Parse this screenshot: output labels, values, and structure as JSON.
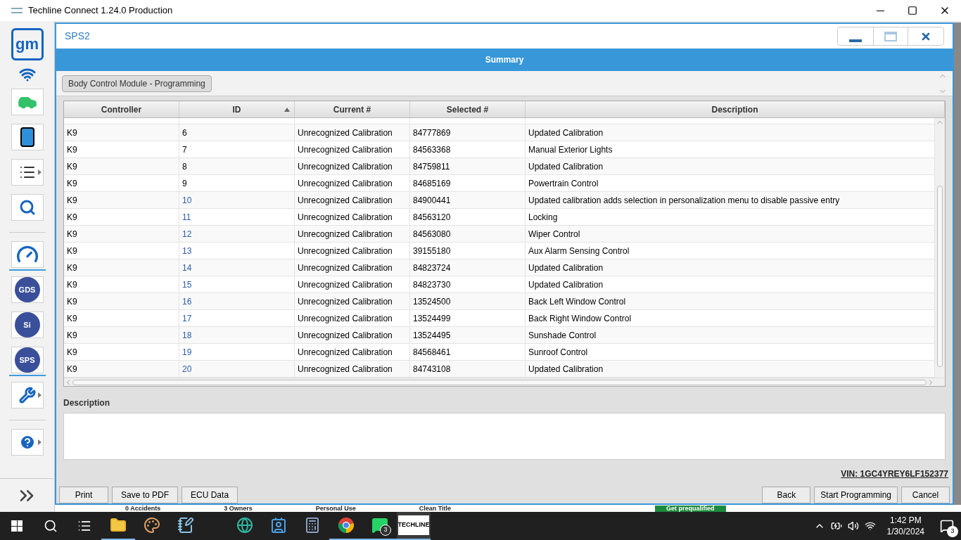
{
  "window": {
    "title": "Techline Connect 1.24.0 Production"
  },
  "sidebar": {
    "logo": "gm",
    "items": [
      {
        "kind": "car",
        "selected": false,
        "menu": false
      },
      {
        "kind": "tablet",
        "selected": false,
        "menu": false
      },
      {
        "kind": "list",
        "selected": false,
        "menu": true
      },
      {
        "kind": "search",
        "selected": false,
        "menu": false
      },
      {
        "kind": "divider"
      },
      {
        "kind": "gauge",
        "selected": true,
        "menu": false
      },
      {
        "kind": "badge",
        "label": "GDS",
        "selected": false,
        "menu": false
      },
      {
        "kind": "badge",
        "label": "Si",
        "selected": false,
        "menu": false
      },
      {
        "kind": "badge",
        "label": "SPS",
        "selected": true,
        "menu": false
      },
      {
        "kind": "wrench",
        "selected": false,
        "menu": true
      },
      {
        "kind": "divider"
      },
      {
        "kind": "help",
        "selected": false,
        "menu": true
      }
    ]
  },
  "dialog": {
    "title": "SPS2",
    "banner": "Summary",
    "module_tab": "Body Control Module - Programming",
    "table": {
      "columns": [
        {
          "label": "Controller",
          "sorted": false
        },
        {
          "label": "ID",
          "sorted": true
        },
        {
          "label": "Current #",
          "sorted": false
        },
        {
          "label": "Selected #",
          "sorted": false
        },
        {
          "label": "Description",
          "sorted": false
        }
      ],
      "rows": [
        {
          "controller": "K9",
          "id": "6",
          "current": "Unrecognized Calibration",
          "selected_no": "84777869",
          "description": "Updated Calibration",
          "color": "#000000"
        },
        {
          "controller": "K9",
          "id": "7",
          "current": "Unrecognized Calibration",
          "selected_no": "84563368",
          "description": "Manual Exterior Lights",
          "color": "#000000"
        },
        {
          "controller": "K9",
          "id": "8",
          "current": "Unrecognized Calibration",
          "selected_no": "84759811",
          "description": "Updated Calibration",
          "color": "#000000"
        },
        {
          "controller": "K9",
          "id": "9",
          "current": "Unrecognized Calibration",
          "selected_no": "84685169",
          "description": "Powertrain Control",
          "color": "#000000"
        },
        {
          "controller": "K9",
          "id": "10",
          "current": "Unrecognized Calibration",
          "selected_no": "84900441",
          "description": "Updated calibration adds selection in personalization menu to  disable passive entry",
          "color": "#2a5caa"
        },
        {
          "controller": "K9",
          "id": "11",
          "current": "Unrecognized Calibration",
          "selected_no": "84563120",
          "description": "Locking",
          "color": "#2a5caa"
        },
        {
          "controller": "K9",
          "id": "12",
          "current": "Unrecognized Calibration",
          "selected_no": "84563080",
          "description": "Wiper Control",
          "color": "#2a5caa"
        },
        {
          "controller": "K9",
          "id": "13",
          "current": "Unrecognized Calibration",
          "selected_no": "39155180",
          "description": "Aux Alarm Sensing Control",
          "color": "#2a5caa"
        },
        {
          "controller": "K9",
          "id": "14",
          "current": "Unrecognized Calibration",
          "selected_no": "84823724",
          "description": "Updated Calibration",
          "color": "#2a5caa"
        },
        {
          "controller": "K9",
          "id": "15",
          "current": "Unrecognized Calibration",
          "selected_no": "84823730",
          "description": "Updated Calibration",
          "color": "#2a5caa"
        },
        {
          "controller": "K9",
          "id": "16",
          "current": "Unrecognized Calibration",
          "selected_no": "13524500",
          "description": "Back Left Window Control",
          "color": "#2a5caa"
        },
        {
          "controller": "K9",
          "id": "17",
          "current": "Unrecognized Calibration",
          "selected_no": "13524499",
          "description": "Back Right Window Control",
          "color": "#2a5caa"
        },
        {
          "controller": "K9",
          "id": "18",
          "current": "Unrecognized Calibration",
          "selected_no": "13524495",
          "description": "Sunshade Control",
          "color": "#2a5caa"
        },
        {
          "controller": "K9",
          "id": "19",
          "current": "Unrecognized Calibration",
          "selected_no": "84568461",
          "description": "Sunroof Control",
          "color": "#2a5caa"
        },
        {
          "controller": "K9",
          "id": "20",
          "current": "Unrecognized Calibration",
          "selected_no": "84743108",
          "description": "Updated Calibration",
          "color": "#2a5caa"
        }
      ]
    },
    "description_label": "Description",
    "vin": "VIN: 1GC4YREY6LF152377",
    "left_buttons": [
      "Print",
      "Save to PDF",
      "ECU Data"
    ],
    "right_buttons": [
      "Back",
      "Start Programming",
      "Cancel"
    ]
  },
  "background_texts": [
    "0 Accidents",
    "3 Owners",
    "Personal Use",
    "Clean Title",
    "Get prequalified"
  ],
  "taskbar": {
    "apps": [
      {
        "kind": "explorer",
        "active": true
      },
      {
        "kind": "paint",
        "active": false
      },
      {
        "kind": "notepad",
        "active": false
      },
      {
        "kind": "edge",
        "active": false
      },
      {
        "kind": "contacts",
        "active": false
      },
      {
        "kind": "calculator",
        "active": false
      },
      {
        "kind": "chrome",
        "active": true
      },
      {
        "kind": "whatsapp",
        "active": true,
        "badge": "3"
      },
      {
        "kind": "techline",
        "active": true,
        "label": "TECHLINE"
      }
    ],
    "time": "1:42 PM",
    "date": "1/30/2024",
    "notifications": "3"
  }
}
